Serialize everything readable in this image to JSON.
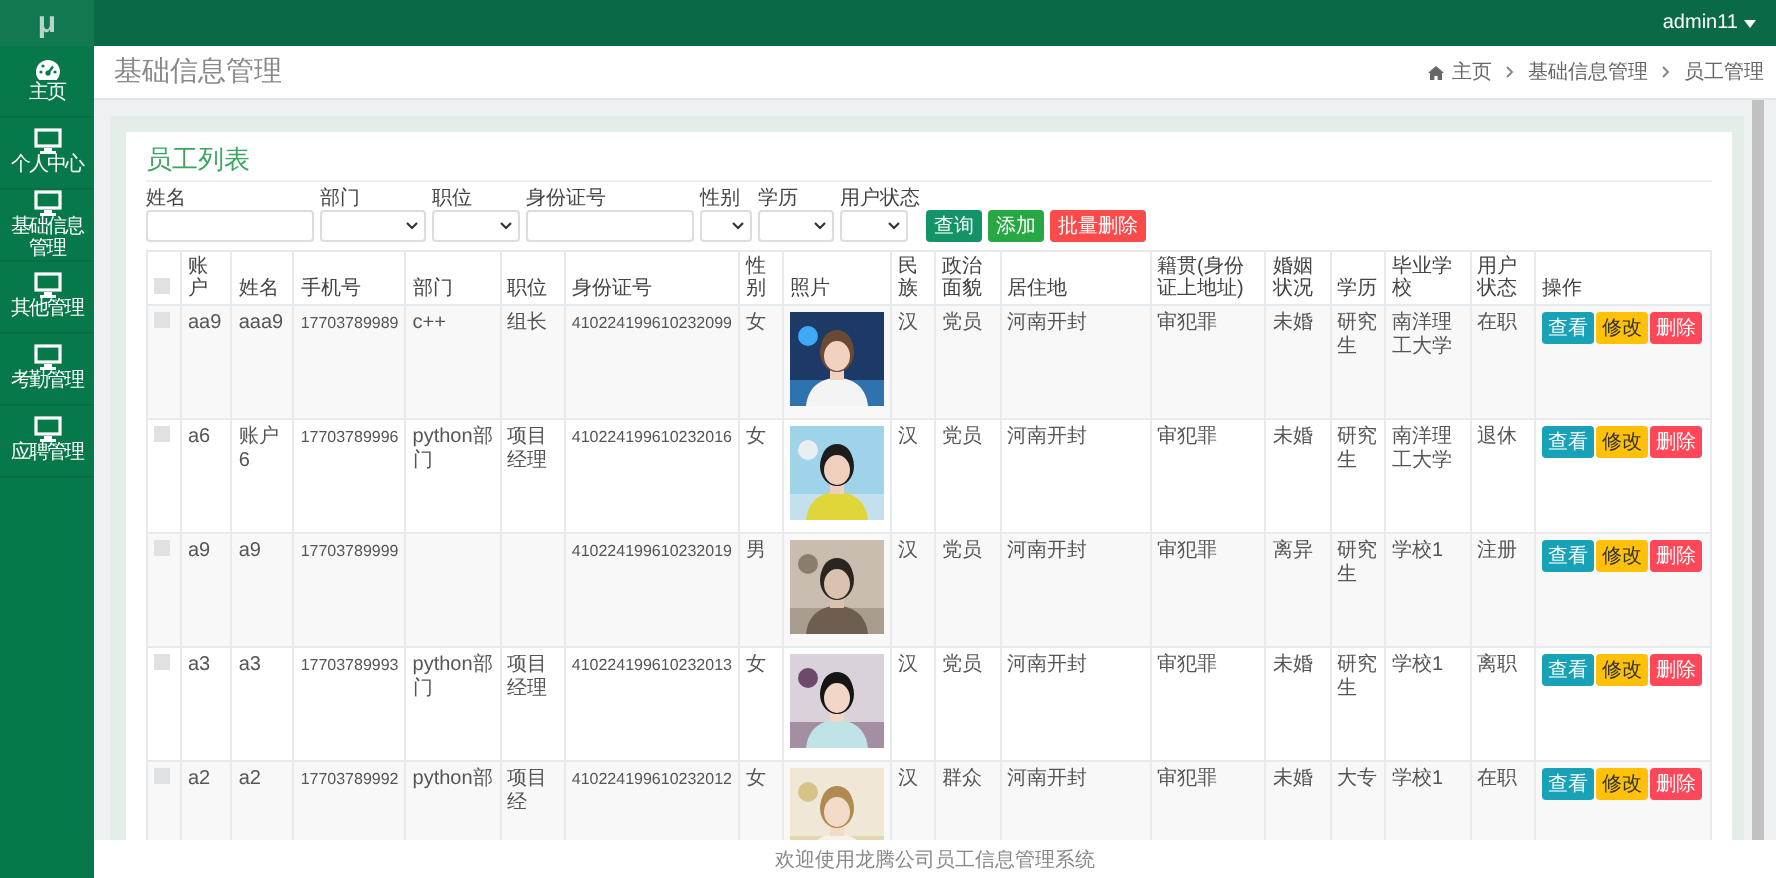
{
  "topbar": {
    "logo": "μ",
    "user": "admin11"
  },
  "sidebar": {
    "items": [
      {
        "label": "主页",
        "kind": "dashboard"
      },
      {
        "label": "个人中心",
        "kind": "monitor"
      },
      {
        "label": "基础信息管理",
        "kind": "monitor"
      },
      {
        "label": "其他管理",
        "kind": "monitor"
      },
      {
        "label": "考勤管理",
        "kind": "monitor"
      },
      {
        "label": "应聘管理",
        "kind": "monitor"
      }
    ]
  },
  "header": {
    "title": "基础信息管理",
    "breadcrumb": [
      "主页",
      "基础信息管理",
      "员工管理"
    ]
  },
  "card": {
    "title": "员工列表",
    "filters": [
      {
        "label": "姓名",
        "kind": "text"
      },
      {
        "label": "部门",
        "kind": "select"
      },
      {
        "label": "职位",
        "kind": "select"
      },
      {
        "label": "身份证号",
        "kind": "text"
      },
      {
        "label": "性别",
        "kind": "select"
      },
      {
        "label": "学历",
        "kind": "select"
      },
      {
        "label": "用户状态",
        "kind": "select"
      }
    ],
    "buttons": [
      {
        "label": "查询",
        "kind": "search"
      },
      {
        "label": "添加",
        "kind": "add"
      },
      {
        "label": "批量删除",
        "kind": "danger"
      }
    ]
  },
  "table": {
    "select_all_checked": false,
    "columns": [
      "账户",
      "姓名",
      "手机号",
      "部门",
      "职位",
      "身份证号",
      "性别",
      "照片",
      "民族",
      "政治面貌",
      "居住地",
      "籍贯(身份证上地址)",
      "婚姻状况",
      "学历",
      "毕业学校",
      "用户状态",
      "操作"
    ],
    "rows": [
      {
        "checked": false,
        "account": "aa9",
        "name": "aaa9",
        "phone": "17703789989",
        "department": "c++",
        "position": "组长",
        "id_number": "410224199610232099",
        "gender": "女",
        "ethnicity": "汉",
        "political_status": "党员",
        "residence": "河南开封",
        "native_place": "审犯罪",
        "marital_status": "未婚",
        "education": "研究生",
        "school": "南洋理工大学",
        "status": "在职",
        "actions": [
          "查看",
          "修改",
          "删除"
        ]
      },
      {
        "checked": false,
        "account": "a6",
        "name": "账户6",
        "phone": "17703789996",
        "department": "python部门",
        "position": "项目经理",
        "id_number": "410224199610232016",
        "gender": "女",
        "ethnicity": "汉",
        "political_status": "党员",
        "residence": "河南开封",
        "native_place": "审犯罪",
        "marital_status": "未婚",
        "education": "研究生",
        "school": "南洋理工大学",
        "status": "退休",
        "actions": [
          "查看",
          "修改",
          "删除"
        ]
      },
      {
        "checked": false,
        "account": "a9",
        "name": "a9",
        "phone": "17703789999",
        "id_number": "410224199610232019",
        "gender": "男",
        "ethnicity": "汉",
        "political_status": "党员",
        "residence": "河南开封",
        "native_place": "审犯罪",
        "marital_status": "离异",
        "education": "研究生",
        "school": "学校1",
        "status": "注册",
        "actions": [
          "查看",
          "修改",
          "删除"
        ]
      },
      {
        "checked": false,
        "account": "a3",
        "name": "a3",
        "phone": "17703789993",
        "department": "python部门",
        "position": "项目经理",
        "id_number": "410224199610232013",
        "gender": "女",
        "ethnicity": "汉",
        "political_status": "党员",
        "residence": "河南开封",
        "native_place": "审犯罪",
        "marital_status": "未婚",
        "education": "研究生",
        "school": "学校1",
        "status": "离职",
        "actions": [
          "查看",
          "修改",
          "删除"
        ]
      },
      {
        "checked": false,
        "account": "a2",
        "name": "a2",
        "phone": "17703789992",
        "department": "python部",
        "position": "项目经",
        "id_number": "410224199610232012",
        "gender": "女",
        "ethnicity": "汉",
        "political_status": "群众",
        "residence": "河南开封",
        "native_place": "审犯罪",
        "marital_status": "未婚",
        "education": "大专",
        "school": "学校1",
        "status": "在职",
        "actions": [
          "查看",
          "修改",
          "删除"
        ]
      }
    ]
  },
  "footer": {
    "text": "欢迎使用龙腾公司员工信息管理系统"
  }
}
